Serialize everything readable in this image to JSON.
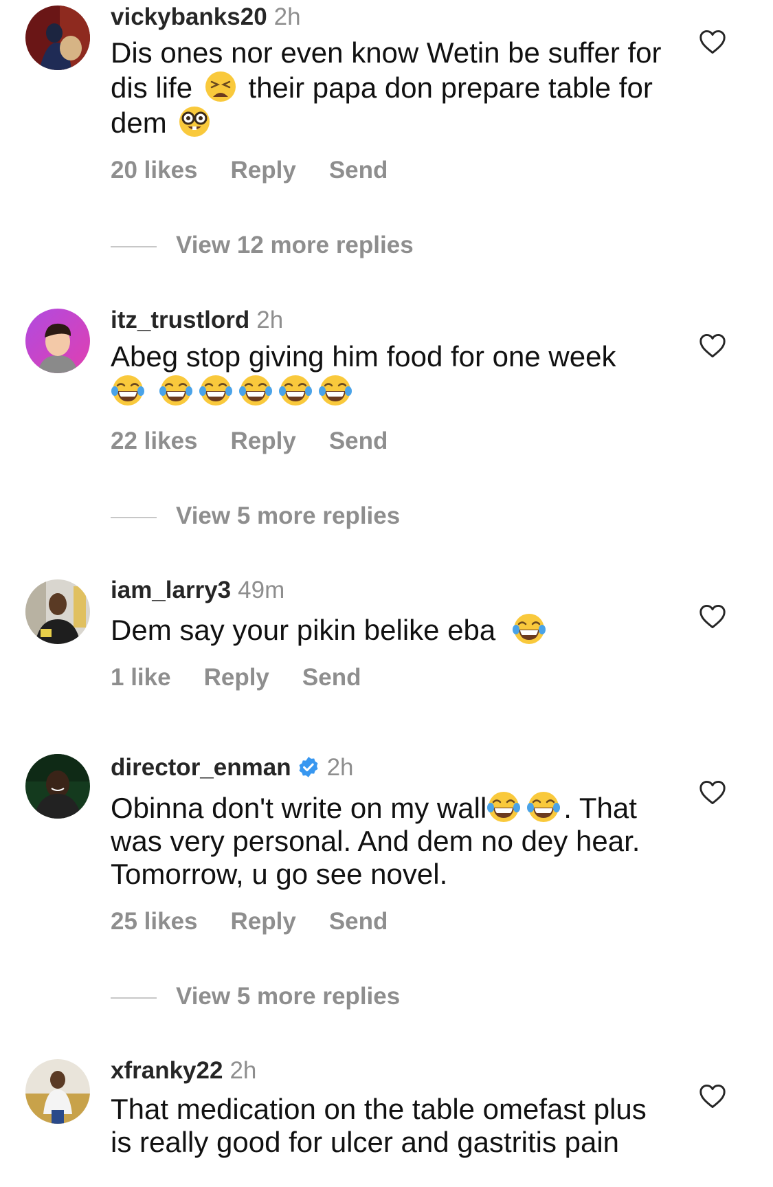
{
  "comments": [
    {
      "username": "vickybanks20",
      "time": "2h",
      "text_parts": [
        "Dis ones nor even know Wetin be suffer for dis life",
        "their papa don prepare table for dem"
      ],
      "likes": "20 likes",
      "reply_label": "Reply",
      "send_label": "Send",
      "view_replies": "View 12 more replies"
    },
    {
      "username": "itz_trustlord",
      "time": "2h",
      "text_parts": [
        "Abeg stop giving him food for one week"
      ],
      "likes": "22 likes",
      "reply_label": "Reply",
      "send_label": "Send",
      "view_replies": "View 5 more replies"
    },
    {
      "username": "iam_larry3",
      "time": "49m",
      "text_parts": [
        "Dem say your pikin belike eba"
      ],
      "likes": "1 like",
      "reply_label": "Reply",
      "send_label": "Send"
    },
    {
      "username": "director_enman",
      "time": "2h",
      "verified": true,
      "text_parts": [
        "Obinna don't write on my wall",
        ".",
        "That was very personal. And dem no dey hear. Tomorrow, u go see novel."
      ],
      "likes": "25 likes",
      "reply_label": "Reply",
      "send_label": "Send",
      "view_replies": "View 5 more replies"
    },
    {
      "username": "xfranky22",
      "time": "2h",
      "text_parts": [
        "That medication on the table omefast plus is really good for ulcer and gastritis pain"
      ]
    }
  ],
  "icons": {
    "heart": "heart-outline-icon",
    "verified": "verified-badge-icon",
    "emoji_weary": "weary-face-emoji",
    "emoji_nerd": "nerd-face-emoji",
    "emoji_laugh": "tears-of-joy-emoji"
  },
  "colors": {
    "secondary_text": "#8e8e8e",
    "verified_blue": "#3897f0"
  }
}
